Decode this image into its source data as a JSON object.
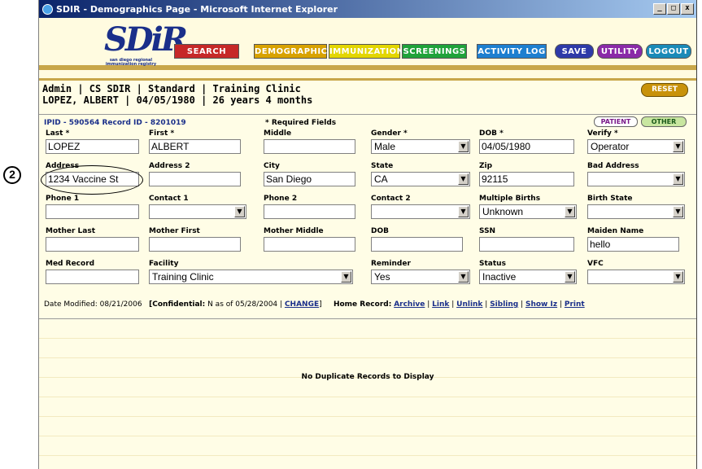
{
  "window": {
    "title": "SDIR - Demographics Page - Microsoft Internet Explorer",
    "controls": [
      "_",
      "□",
      "x"
    ]
  },
  "logo": {
    "text": "SDiR",
    "subtext": "san diego regional immunization registry"
  },
  "nav": {
    "search": "SEARCH",
    "demographics": "DEMOGRAPHICS",
    "immunization": "IMMUNIZATION",
    "screenings": "SCREENINGS",
    "activity_log": "ACTIVITY LOG",
    "save": "SAVE",
    "utility": "UTILITY",
    "logout": "LOGOUT"
  },
  "session": {
    "line1": "Admin | CS SDIR | Standard | Training Clinic",
    "line2": "LOPEZ, ALBERT | 04/05/1980 | 26 years 4 months",
    "reset": "RESET"
  },
  "ids": {
    "text": "IPID - 590564 Record ID - 8201019",
    "required": "* Required Fields",
    "patient_tab": "PATIENT",
    "other_tab": "OTHER"
  },
  "labels": {
    "last": "Last *",
    "first": "First *",
    "middle": "Middle",
    "gender": "Gender *",
    "dob": "DOB *",
    "verify": "Verify *",
    "address": "Address",
    "address2": "Address 2",
    "city": "City",
    "state": "State",
    "zip": "Zip",
    "bad_address": "Bad Address",
    "phone1": "Phone 1",
    "contact1": "Contact 1",
    "phone2": "Phone 2",
    "contact2": "Contact 2",
    "multiple_births": "Multiple Births",
    "birth_state": "Birth State",
    "mother_last": "Mother Last",
    "mother_first": "Mother First",
    "mother_middle": "Mother Middle",
    "mother_dob": "DOB",
    "ssn": "SSN",
    "maiden_name": "Maiden Name",
    "med_record": "Med Record",
    "facility": "Facility",
    "reminder": "Reminder",
    "status": "Status",
    "vfc": "VFC"
  },
  "values": {
    "last": "LOPEZ",
    "first": "ALBERT",
    "middle": "",
    "gender": "Male",
    "dob": "04/05/1980",
    "verify": "Operator",
    "address": "1234 Vaccine  St",
    "address2": "",
    "city": "San Diego",
    "state": "CA",
    "zip": "92115",
    "bad_address": "",
    "phone1": "",
    "contact1": "",
    "phone2": "",
    "contact2": "",
    "multiple_births": "Unknown",
    "birth_state": "",
    "mother_last": "",
    "mother_first": "",
    "mother_middle": "",
    "mother_dob": "",
    "ssn": "",
    "maiden_name": "hello",
    "med_record": "",
    "facility": "Training Clinic",
    "reminder": "Yes",
    "status": "Inactive",
    "vfc": ""
  },
  "footer": {
    "date_modified": "Date Modified: 08/21/2006",
    "confidential_label": "[Confidential:",
    "confidential_value": "N as of 05/28/2004 |",
    "change": "CHANGE",
    "close_bracket": "]",
    "home_record": "Home Record:",
    "archive": "Archive",
    "link": "Link",
    "unlink": "Unlink",
    "sibling": "Sibling",
    "show_iz": "Show Iz",
    "print": "Print"
  },
  "duplicates": {
    "message": "No Duplicate Records to Display"
  },
  "callout": {
    "number": "2"
  }
}
